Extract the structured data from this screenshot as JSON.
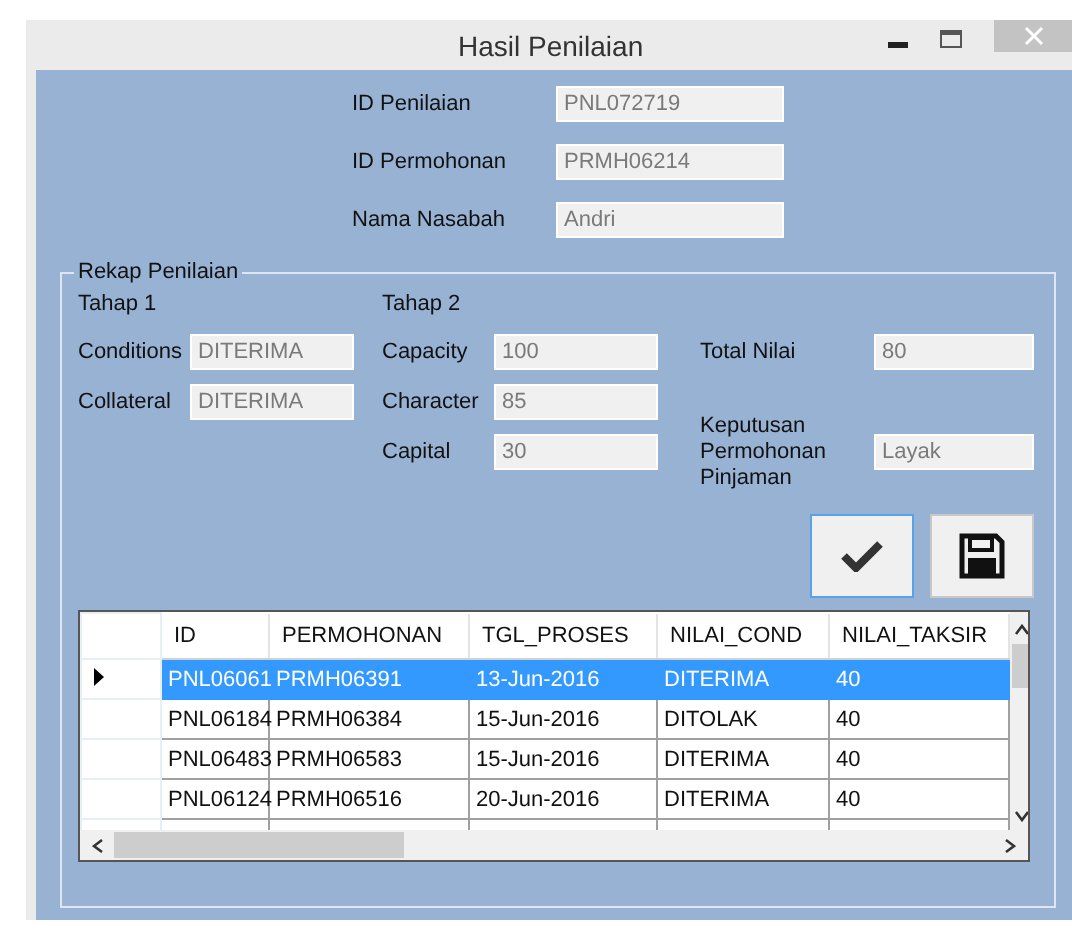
{
  "window": {
    "title": "Hasil Penilaian"
  },
  "header_fields": [
    {
      "label": "ID Penilaian",
      "value": "PNL072719"
    },
    {
      "label": "ID Permohonan",
      "value": "PRMH06214"
    },
    {
      "label": "Nama Nasabah",
      "value": "Andri"
    }
  ],
  "rekap": {
    "title": "Rekap Penilaian",
    "stage_1": {
      "title": "Tahap 1",
      "fields": [
        {
          "label": "Conditions",
          "value": "DITERIMA"
        },
        {
          "label": "Collateral",
          "value": "DITERIMA"
        }
      ]
    },
    "stage_2": {
      "title": "Tahap 2",
      "fields": [
        {
          "label": "Capacity",
          "value": "100"
        },
        {
          "label": "Character",
          "value": "85"
        },
        {
          "label": "Capital",
          "value": "30"
        }
      ]
    },
    "total": {
      "label": "Total Nilai",
      "value": "80"
    },
    "decision": {
      "label": "Keputusan Permohonan Pinjaman",
      "value": "Layak"
    }
  },
  "table": {
    "columns": [
      "ID",
      "PERMOHONAN",
      "TGL_PROSES",
      "NILAI_COND",
      "NILAI_TAKSIR"
    ],
    "rows": [
      {
        "selected": true,
        "cells": [
          "PNL06061",
          "PRMH06391",
          "13-Jun-2016",
          "DITERIMA",
          "40"
        ]
      },
      {
        "selected": false,
        "cells": [
          "PNL06184",
          "PRMH06384",
          "15-Jun-2016",
          "DITOLAK",
          "40"
        ]
      },
      {
        "selected": false,
        "cells": [
          "PNL06483",
          "PRMH06583",
          "15-Jun-2016",
          "DITERIMA",
          "40"
        ]
      },
      {
        "selected": false,
        "cells": [
          "PNL06124",
          "PRMH06516",
          "20-Jun-2016",
          "DITERIMA",
          "40"
        ]
      }
    ]
  }
}
